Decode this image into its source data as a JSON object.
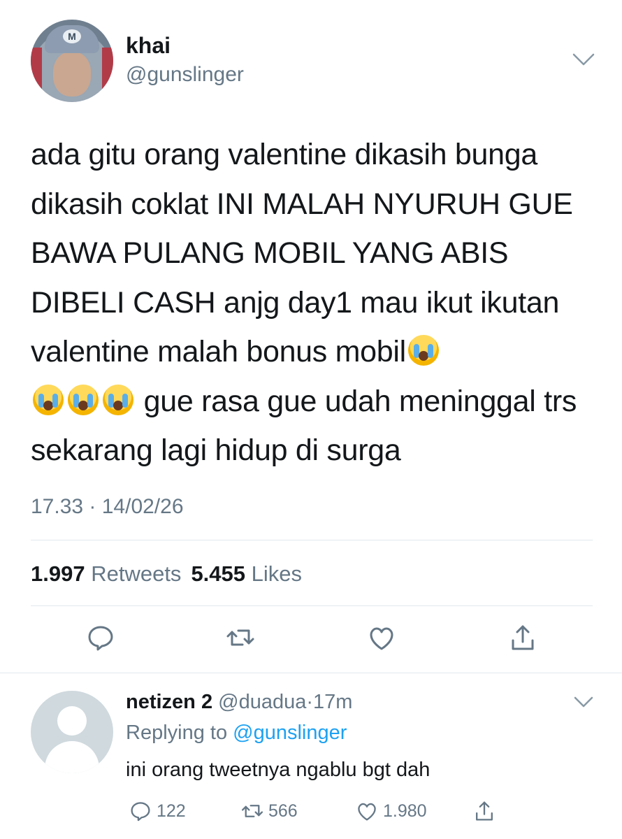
{
  "tweet": {
    "author_name": "khai",
    "author_handle": "@gunslinger",
    "avatar_cap_letter": "M",
    "text_part1": "ada gitu orang valentine dikasih bunga dikasih coklat INI MALAH NYURUH GUE BAWA PULANG MOBIL YANG ABIS DIBELI CASH anjg day1 mau ikut ikutan valentine malah bonus mobil",
    "text_part2": " gue rasa gue udah meninggal trs sekarang lagi hidup di surga",
    "emoji": "loudly-crying-face",
    "timestamp": "17.33 · 14/02/26",
    "retweets_count": "1.997",
    "retweets_label": "Retweets",
    "likes_count": "5.455",
    "likes_label": "Likes",
    "actions": [
      "reply-icon",
      "retweet-icon",
      "like-icon",
      "share-icon"
    ]
  },
  "reply": {
    "name": "netizen 2",
    "handle": "@duadua",
    "time": "17m",
    "replying_prefix": "Replying to",
    "replying_to": "@gunslinger",
    "text": "ini orang tweetnya ngablu bgt dah",
    "reply_count": "122",
    "retweet_count": "566",
    "like_count": "1.980"
  },
  "colors": {
    "text": "#14171a",
    "secondary": "#657786",
    "link": "#1da1f2",
    "divider": "#e1e8ed"
  }
}
